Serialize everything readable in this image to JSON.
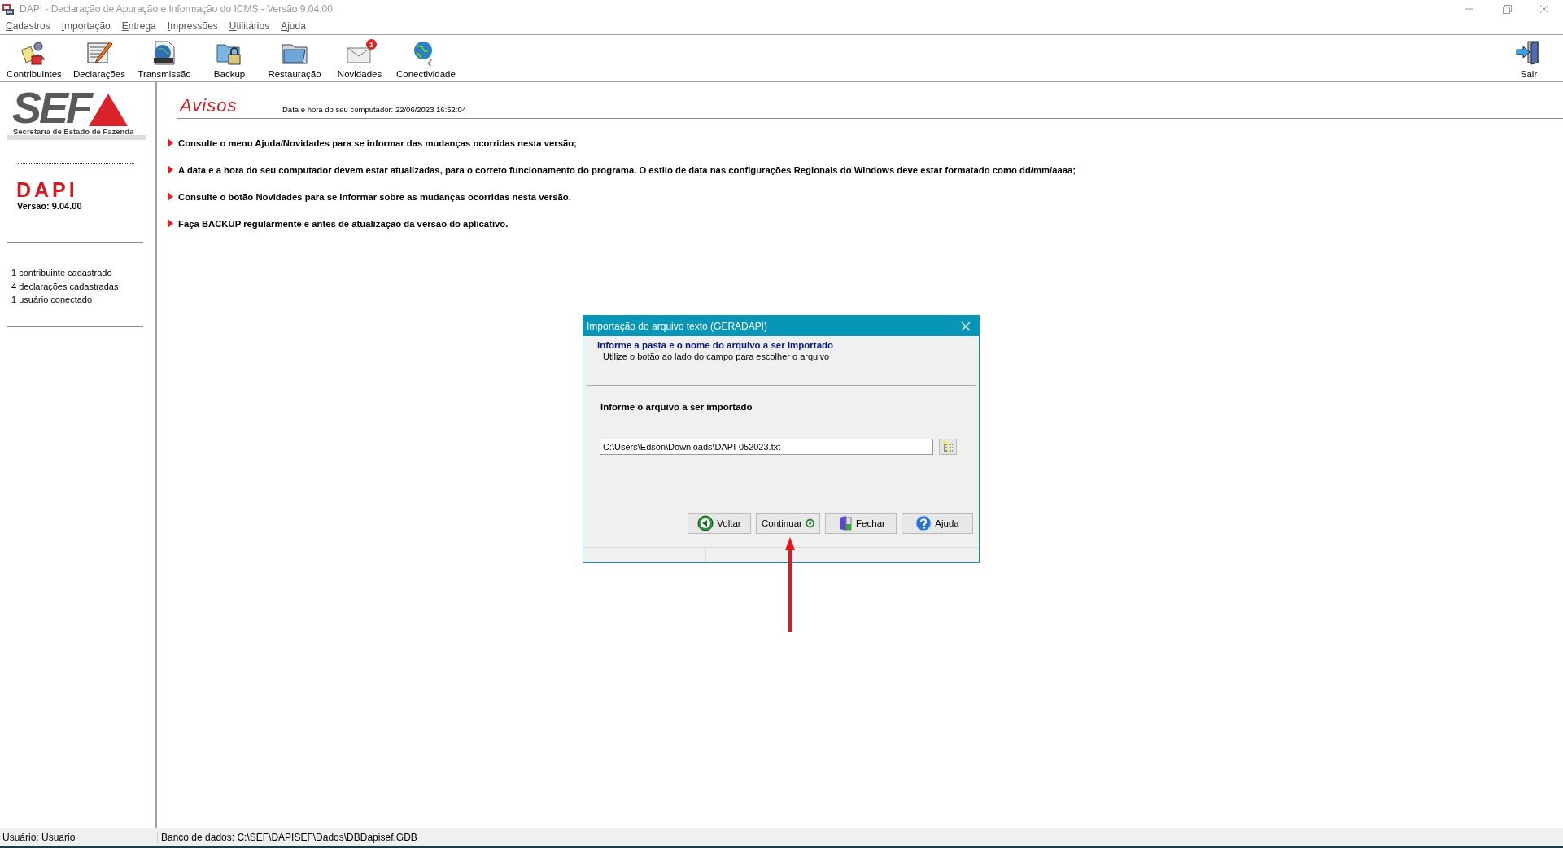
{
  "window": {
    "title": "DAPI - Declaração de Apuração e Informação do ICMS - Versão 9.04.00"
  },
  "menu": [
    "Cadastros",
    "Importação",
    "Entrega",
    "Impressões",
    "Utilitários",
    "Ajuda"
  ],
  "toolbar": [
    {
      "label": "Contribuintes",
      "kind": "contributors"
    },
    {
      "label": "Declarações",
      "kind": "declarations"
    },
    {
      "label": "Transmissão",
      "kind": "transmission"
    },
    {
      "label": "Backup",
      "kind": "backup"
    },
    {
      "label": "Restauração",
      "kind": "restore"
    },
    {
      "label": "Novidades",
      "kind": "news",
      "badge": "1"
    },
    {
      "label": "Conectividade",
      "kind": "connectivity"
    }
  ],
  "toolbar_right": {
    "label": "Sair"
  },
  "sidebar": {
    "logo_text": "SEF",
    "logo_subtitle": "Secretaria de Estado de Fazenda",
    "app_name": "DAPI",
    "version": "Versão: 9.04.00",
    "stats": [
      "1 contribuinte cadastrado",
      "4 declarações cadastradas",
      "1 usuário conectado"
    ]
  },
  "notices": {
    "title": "Avisos",
    "datetime": "Data e hora do seu computador: 22/06/2023 16:52:04",
    "items": [
      "Consulte o menu Ajuda/Novidades para se informar das mudanças ocorridas nesta versão;",
      "A data e a hora do seu computador devem estar atualizadas, para o correto funcionamento do programa. O estilo de data nas configurações Regionais do Windows deve estar formatado como dd/mm/aaaa;",
      "Consulte o botão Novidades para se informar sobre as mudanças ocorridas nesta versão.",
      "Faça BACKUP regularmente e antes de atualização da versão do aplicativo."
    ]
  },
  "dialog": {
    "title": "Importação do arquivo texto (GERADAPI)",
    "heading": "Informe a pasta e o nome do arquivo a ser importado",
    "subheading": "Utilize o botão ao lado do campo para escolher o arquivo",
    "group_label": "Informe o arquivo a ser importado",
    "file_path": "C:\\Users\\Edson\\Downloads\\DAPI-052023.txt",
    "buttons": [
      {
        "label": "Voltar",
        "kind": "back"
      },
      {
        "label": "Continuar",
        "kind": "next"
      },
      {
        "label": "Fechar",
        "kind": "close"
      },
      {
        "label": "Ajuda",
        "kind": "help"
      }
    ]
  },
  "status_bar": {
    "user": "Usuário: Usuario",
    "database": "Banco de dados: C:\\SEF\\DAPISEF\\Dados\\DBDapisef.GDB"
  }
}
